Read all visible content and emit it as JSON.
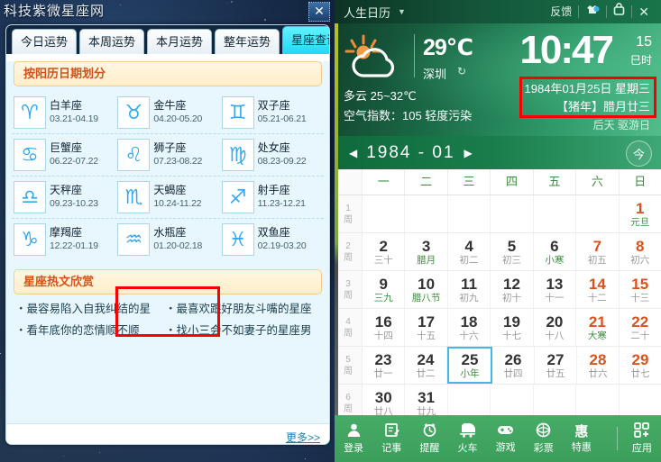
{
  "desktop": {
    "name": "starry-desktop-wallpaper"
  },
  "zodiac_window": {
    "site_title": "科技紫微星座网",
    "close_label": "✕",
    "tabs": [
      {
        "label": "今日运势",
        "active": false
      },
      {
        "label": "本周运势",
        "active": false
      },
      {
        "label": "本月运势",
        "active": false
      },
      {
        "label": "整年运势",
        "active": false
      },
      {
        "label": "星座查询",
        "active": true
      }
    ],
    "section_title": "按阳历日期划分",
    "signs": [
      {
        "name": "白羊座",
        "date": "03.21-04.19",
        "glyph": "♈",
        "highlight": false
      },
      {
        "name": "金牛座",
        "date": "04.20-05.20",
        "glyph": "♉",
        "highlight": false
      },
      {
        "name": "双子座",
        "date": "05.21-06.21",
        "glyph": "♊",
        "highlight": false
      },
      {
        "name": "巨蟹座",
        "date": "06.22-07.22",
        "glyph": "♋",
        "highlight": false
      },
      {
        "name": "狮子座",
        "date": "07.23-08.22",
        "glyph": "♌",
        "highlight": false
      },
      {
        "name": "处女座",
        "date": "08.23-09.22",
        "glyph": "♍",
        "highlight": false
      },
      {
        "name": "天秤座",
        "date": "09.23-10.23",
        "glyph": "♎",
        "highlight": false
      },
      {
        "name": "天蝎座",
        "date": "10.24-11.22",
        "glyph": "♏",
        "highlight": false
      },
      {
        "name": "射手座",
        "date": "11.23-12.21",
        "glyph": "♐",
        "highlight": false
      },
      {
        "name": "摩羯座",
        "date": "12.22-01.19",
        "glyph": "♑",
        "highlight": false
      },
      {
        "name": "水瓶座",
        "date": "01.20-02.18",
        "glyph": "♒",
        "highlight": true
      },
      {
        "name": "双鱼座",
        "date": "02.19-03.20",
        "glyph": "♓",
        "highlight": false
      }
    ],
    "hot_title": "星座热文欣赏",
    "hot_items": [
      "・最容易陷入自我纠结的星",
      "・最喜欢跟好朋友斗嘴的星座",
      "・看年底你的恋情顺不顺",
      "・找小三会不如妻子的星座男"
    ],
    "more_label": "更多>>"
  },
  "calendar_app": {
    "titlebar": {
      "title": "人生日历",
      "caret": "▼",
      "feedback_label": "反馈",
      "skin_icon": "skin-icon",
      "lock_icon": "lock-icon",
      "close_icon": "✕"
    },
    "weather": {
      "icon": "sun-cloud-icon",
      "temperature": "29℃",
      "city": "深圳",
      "refresh_icon": "↻",
      "description": "多云 25~32℃",
      "air_quality": "空气指数：105 轻度污染"
    },
    "clock": {
      "time": "10:47",
      "lunar_hour_num": "15",
      "lunar_hour_text": "巳时"
    },
    "date_info": {
      "line1": "1984年01月25日  星期三",
      "line2": "【猪年】腊月廿三",
      "line3": "后天 驱游日",
      "highlighted": true
    },
    "month_nav": {
      "prev_icon": "◀",
      "label": "1984 - 01",
      "next_icon": "▶",
      "today_label": "今"
    },
    "weekdays": [
      "一",
      "二",
      "三",
      "四",
      "五",
      "六",
      "日"
    ],
    "week_suffix": "周",
    "weeks": [
      {
        "num": "1",
        "days": [
          null,
          null,
          null,
          null,
          null,
          null,
          {
            "d": "1",
            "sub": "元旦",
            "weekend": true,
            "fest": true,
            "sel": false
          }
        ]
      },
      {
        "num": "2",
        "days": [
          {
            "d": "2",
            "sub": "三十",
            "weekend": false,
            "fest": false,
            "sel": false
          },
          {
            "d": "3",
            "sub": "腊月",
            "weekend": false,
            "fest": true,
            "sel": false
          },
          {
            "d": "4",
            "sub": "初二",
            "weekend": false,
            "fest": false,
            "sel": false
          },
          {
            "d": "5",
            "sub": "初三",
            "weekend": false,
            "fest": false,
            "sel": false
          },
          {
            "d": "6",
            "sub": "小寒",
            "weekend": false,
            "fest": true,
            "sel": false
          },
          {
            "d": "7",
            "sub": "初五",
            "weekend": true,
            "fest": false,
            "sel": false
          },
          {
            "d": "8",
            "sub": "初六",
            "weekend": true,
            "fest": false,
            "sel": false
          }
        ]
      },
      {
        "num": "3",
        "days": [
          {
            "d": "9",
            "sub": "三九",
            "weekend": false,
            "fest": true,
            "sel": false
          },
          {
            "d": "10",
            "sub": "腊八节",
            "weekend": false,
            "fest": true,
            "sel": false
          },
          {
            "d": "11",
            "sub": "初九",
            "weekend": false,
            "fest": false,
            "sel": false
          },
          {
            "d": "12",
            "sub": "初十",
            "weekend": false,
            "fest": false,
            "sel": false
          },
          {
            "d": "13",
            "sub": "十一",
            "weekend": false,
            "fest": false,
            "sel": false
          },
          {
            "d": "14",
            "sub": "十二",
            "weekend": true,
            "fest": false,
            "sel": false
          },
          {
            "d": "15",
            "sub": "十三",
            "weekend": true,
            "fest": false,
            "sel": false
          }
        ]
      },
      {
        "num": "4",
        "days": [
          {
            "d": "16",
            "sub": "十四",
            "weekend": false,
            "fest": false,
            "sel": false
          },
          {
            "d": "17",
            "sub": "十五",
            "weekend": false,
            "fest": false,
            "sel": false
          },
          {
            "d": "18",
            "sub": "十六",
            "weekend": false,
            "fest": false,
            "sel": false
          },
          {
            "d": "19",
            "sub": "十七",
            "weekend": false,
            "fest": false,
            "sel": false
          },
          {
            "d": "20",
            "sub": "十八",
            "weekend": false,
            "fest": false,
            "sel": false
          },
          {
            "d": "21",
            "sub": "大寒",
            "weekend": true,
            "fest": true,
            "sel": false
          },
          {
            "d": "22",
            "sub": "二十",
            "weekend": true,
            "fest": false,
            "sel": false
          }
        ]
      },
      {
        "num": "5",
        "days": [
          {
            "d": "23",
            "sub": "廿一",
            "weekend": false,
            "fest": false,
            "sel": false
          },
          {
            "d": "24",
            "sub": "廿二",
            "weekend": false,
            "fest": false,
            "sel": false
          },
          {
            "d": "25",
            "sub": "小年",
            "weekend": false,
            "fest": true,
            "sel": true
          },
          {
            "d": "26",
            "sub": "廿四",
            "weekend": false,
            "fest": false,
            "sel": false
          },
          {
            "d": "27",
            "sub": "廿五",
            "weekend": false,
            "fest": false,
            "sel": false
          },
          {
            "d": "28",
            "sub": "廿六",
            "weekend": true,
            "fest": false,
            "sel": false
          },
          {
            "d": "29",
            "sub": "廿七",
            "weekend": true,
            "fest": false,
            "sel": false
          }
        ]
      },
      {
        "num": "6",
        "days": [
          {
            "d": "30",
            "sub": "廿八",
            "weekend": false,
            "fest": false,
            "sel": false
          },
          {
            "d": "31",
            "sub": "廿九",
            "weekend": false,
            "fest": false,
            "sel": false
          },
          null,
          null,
          null,
          null,
          null
        ]
      }
    ],
    "bottom_bar": [
      {
        "label": "登录",
        "icon": "user-icon"
      },
      {
        "label": "记事",
        "icon": "note-icon"
      },
      {
        "label": "提醒",
        "icon": "alarm-icon"
      },
      {
        "label": "火车",
        "icon": "train-icon"
      },
      {
        "label": "游戏",
        "icon": "gamepad-icon"
      },
      {
        "label": "彩票",
        "icon": "lottery-icon"
      },
      {
        "label": "特惠",
        "icon": "discount-icon"
      },
      {
        "label": "应用",
        "icon": "apps-icon"
      }
    ]
  },
  "colors": {
    "accent_cyan": "#25d6f5",
    "calendar_green": "#3d9e5c",
    "highlight_red": "#f70000",
    "weekend_orange": "#d9521b",
    "festival_green": "#3c8c3c",
    "selected_blue": "#46b6e8"
  }
}
